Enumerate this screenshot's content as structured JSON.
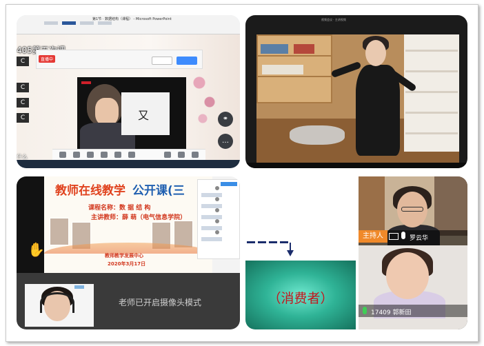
{
  "panel1": {
    "window_title": "第1节 · 数据结构（课程） - Microsoft PowerPoint",
    "lesson_title": "405第五次课",
    "live_badge": "直播中",
    "side_labels": [
      "C",
      "C",
      "C",
      "C"
    ],
    "bottom_text": "什么",
    "video_char": "又",
    "toolbar_icons": [
      "mic-icon",
      "camera-icon",
      "share-screen-icon",
      "whiteboard-icon",
      "record-icon",
      "more-icon"
    ],
    "round_buttons": [
      "link-icon",
      "more-icon"
    ]
  },
  "panel2": {
    "caption": "视频会议 · 主讲视频"
  },
  "panel3": {
    "title_part1": "教师在线教学",
    "title_part2": "公开课(三",
    "course_line": "课程名称：数 据 结 构",
    "teacher_line": "主讲教师：薛 萌（电气信息学院）",
    "center_line": "教师教学发展中心",
    "date_line": "2020年3月17日",
    "hand_icon": "hand-cursor-icon"
  },
  "panel3b": {
    "camera_message": "老师已开启摄像头模式"
  },
  "consumer": {
    "label": "（消费者）"
  },
  "panel4": {
    "host_badge": "主持人",
    "host_name": "罗云华",
    "participant_name": "17409 郭新田",
    "accent_orange": "#f0892a"
  }
}
